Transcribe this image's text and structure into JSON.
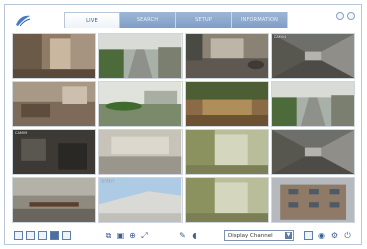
{
  "tabs": [
    {
      "label": "LIVE",
      "active": true
    },
    {
      "label": "SEARCH",
      "active": false
    },
    {
      "label": "SETUP",
      "active": false
    },
    {
      "label": "INFORMATION",
      "active": false
    }
  ],
  "channels": [
    {
      "label": "",
      "stamp": "",
      "res": "",
      "scene": "room-door"
    },
    {
      "label": "",
      "stamp": "",
      "res": "",
      "scene": "outdoor-path"
    },
    {
      "label": "",
      "stamp": "",
      "res": "",
      "scene": "lobby"
    },
    {
      "label": "CAM04",
      "stamp": "",
      "res": "",
      "scene": "corridor"
    },
    {
      "label": "",
      "stamp": "",
      "res": "",
      "scene": "room-floor"
    },
    {
      "label": "",
      "stamp": "",
      "res": "",
      "scene": "garden"
    },
    {
      "label": "",
      "stamp": "",
      "res": "",
      "scene": "courtyard"
    },
    {
      "label": "",
      "stamp": "",
      "res": "",
      "scene": "outdoor-path"
    },
    {
      "label": "CAM09",
      "stamp": "",
      "res": "",
      "scene": "dark-room"
    },
    {
      "label": "",
      "stamp": "",
      "res": "",
      "scene": "wall-room"
    },
    {
      "label": "",
      "stamp": "",
      "res": "",
      "scene": "green-room"
    },
    {
      "label": "",
      "stamp": "",
      "res": "",
      "scene": "corridor"
    },
    {
      "label": "",
      "stamp": "",
      "res": "",
      "scene": "bench"
    },
    {
      "label": "CAM14",
      "stamp": "",
      "res": "",
      "scene": "sky-roof"
    },
    {
      "label": "",
      "stamp": "",
      "res": "",
      "scene": "green-room"
    },
    {
      "label": "",
      "stamp": "",
      "res": "",
      "scene": "building"
    }
  ],
  "toolbar": {
    "display_select": "Display Channel"
  },
  "colors": {
    "accent": "#2f5f98",
    "tab_inactive": "#8aa6cc",
    "frame_border": "#b9c6d8"
  }
}
